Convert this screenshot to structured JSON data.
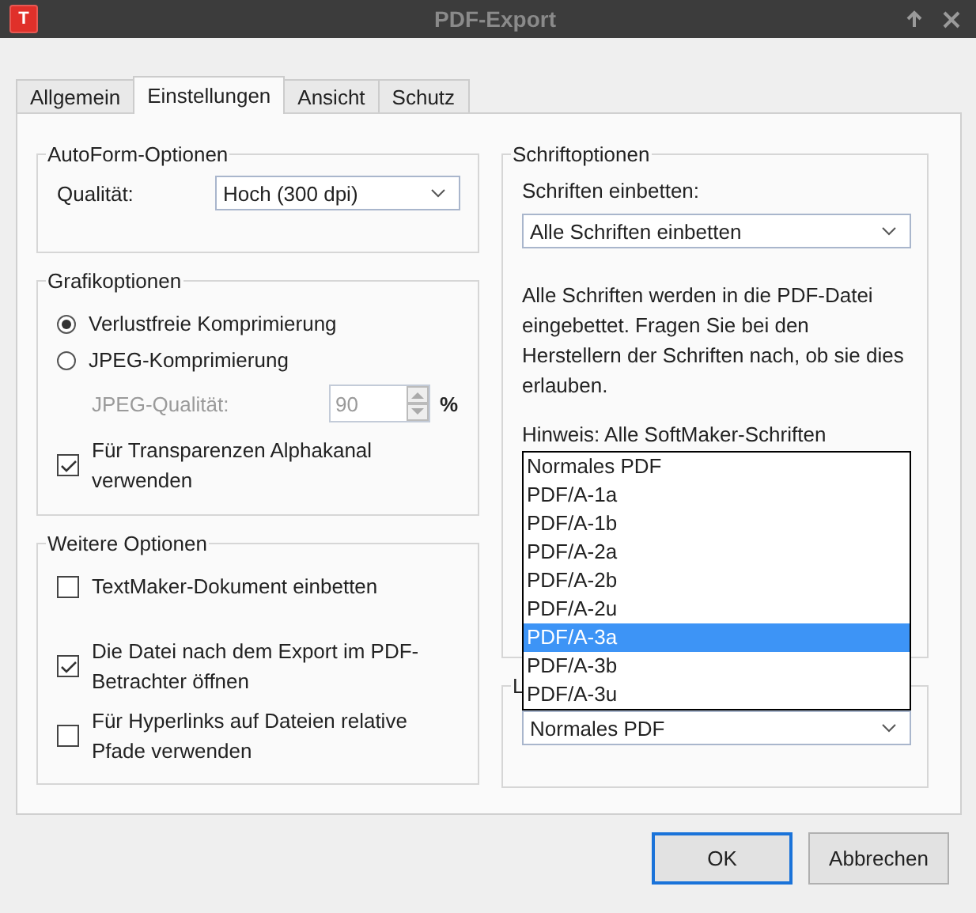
{
  "window": {
    "title": "PDF-Export",
    "app_icon": "T"
  },
  "tabs": [
    {
      "label": "Allgemein",
      "selected": false
    },
    {
      "label": "Einstellungen",
      "selected": true
    },
    {
      "label": "Ansicht",
      "selected": false
    },
    {
      "label": "Schutz",
      "selected": false
    }
  ],
  "autoform": {
    "title": "AutoForm-Optionen",
    "quality_label": "Qualität:",
    "quality_value": "Hoch (300 dpi)"
  },
  "graphics": {
    "title": "Grafikoptionen",
    "options": [
      {
        "label": "Verlustfreie Komprimierung",
        "selected": true
      },
      {
        "label": "JPEG-Komprimierung",
        "selected": false
      }
    ],
    "jpeg_quality": {
      "label": "JPEG-Qualität:",
      "value": "90",
      "unit": "%",
      "disabled": true
    },
    "alpha": {
      "label": "Für Transparenzen Alphakanal verwenden",
      "checked": true
    }
  },
  "more": {
    "title": "Weitere Optionen",
    "checkboxes": [
      {
        "label": "TextMaker-Dokument einbetten",
        "checked": false
      },
      {
        "label": "Die Datei nach dem Export im PDF-Betrachter öffnen",
        "checked": true
      },
      {
        "label": "Für Hyperlinks auf Dateien relative Pfade verwenden",
        "checked": false
      }
    ]
  },
  "fonts": {
    "title": "Schriftoptionen",
    "embed_label": "Schriften einbetten:",
    "embed_value": "Alle Schriften einbetten",
    "description": "Alle Schriften werden in die PDF-Datei eingebettet. Fragen Sie bei den Herstellern der Schriften nach, ob sie dies erlauben.",
    "hint": "Hinweis: Alle SoftMaker-Schriften"
  },
  "pdf_type": {
    "title": "L",
    "value": "Normales PDF",
    "open_list": [
      {
        "label": "Normales PDF",
        "highlighted": false
      },
      {
        "label": "PDF/A-1a",
        "highlighted": false
      },
      {
        "label": "PDF/A-1b",
        "highlighted": false
      },
      {
        "label": "PDF/A-2a",
        "highlighted": false
      },
      {
        "label": "PDF/A-2b",
        "highlighted": false
      },
      {
        "label": "PDF/A-2u",
        "highlighted": false
      },
      {
        "label": "PDF/A-3a",
        "highlighted": true
      },
      {
        "label": "PDF/A-3b",
        "highlighted": false
      },
      {
        "label": "PDF/A-3u",
        "highlighted": false
      }
    ]
  },
  "buttons": [
    {
      "label": "OK",
      "default": true
    },
    {
      "label": "Abbrechen",
      "default": false
    }
  ]
}
